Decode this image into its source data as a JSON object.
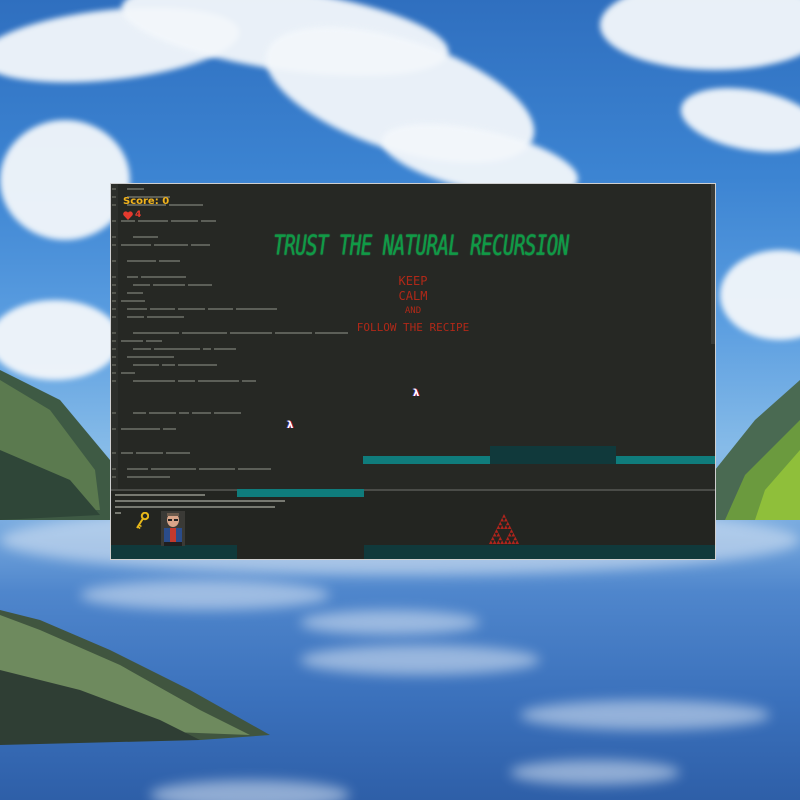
{
  "hud": {
    "score_label": "Score:",
    "score_value": "0",
    "lives": "4"
  },
  "title": "TRUST THE NATURAL RECURSION",
  "motto": {
    "line1": "KEEP",
    "line2": "CALM",
    "line3": "AND",
    "line4": "FOLLOW THE RECIPE"
  },
  "lambda_glyph": "λ",
  "colors": {
    "title": "#0f9b45",
    "motto": "#b02818",
    "score": "#f2b31c",
    "platform": "#0f7c7c",
    "ground": "#10393b",
    "editor_bg": "#262824"
  },
  "icons": {
    "lives": "heart-icon",
    "pickup": "key-icon",
    "collectible": "lambda-icon",
    "enemy": "sierpinski-triangle-icon"
  }
}
